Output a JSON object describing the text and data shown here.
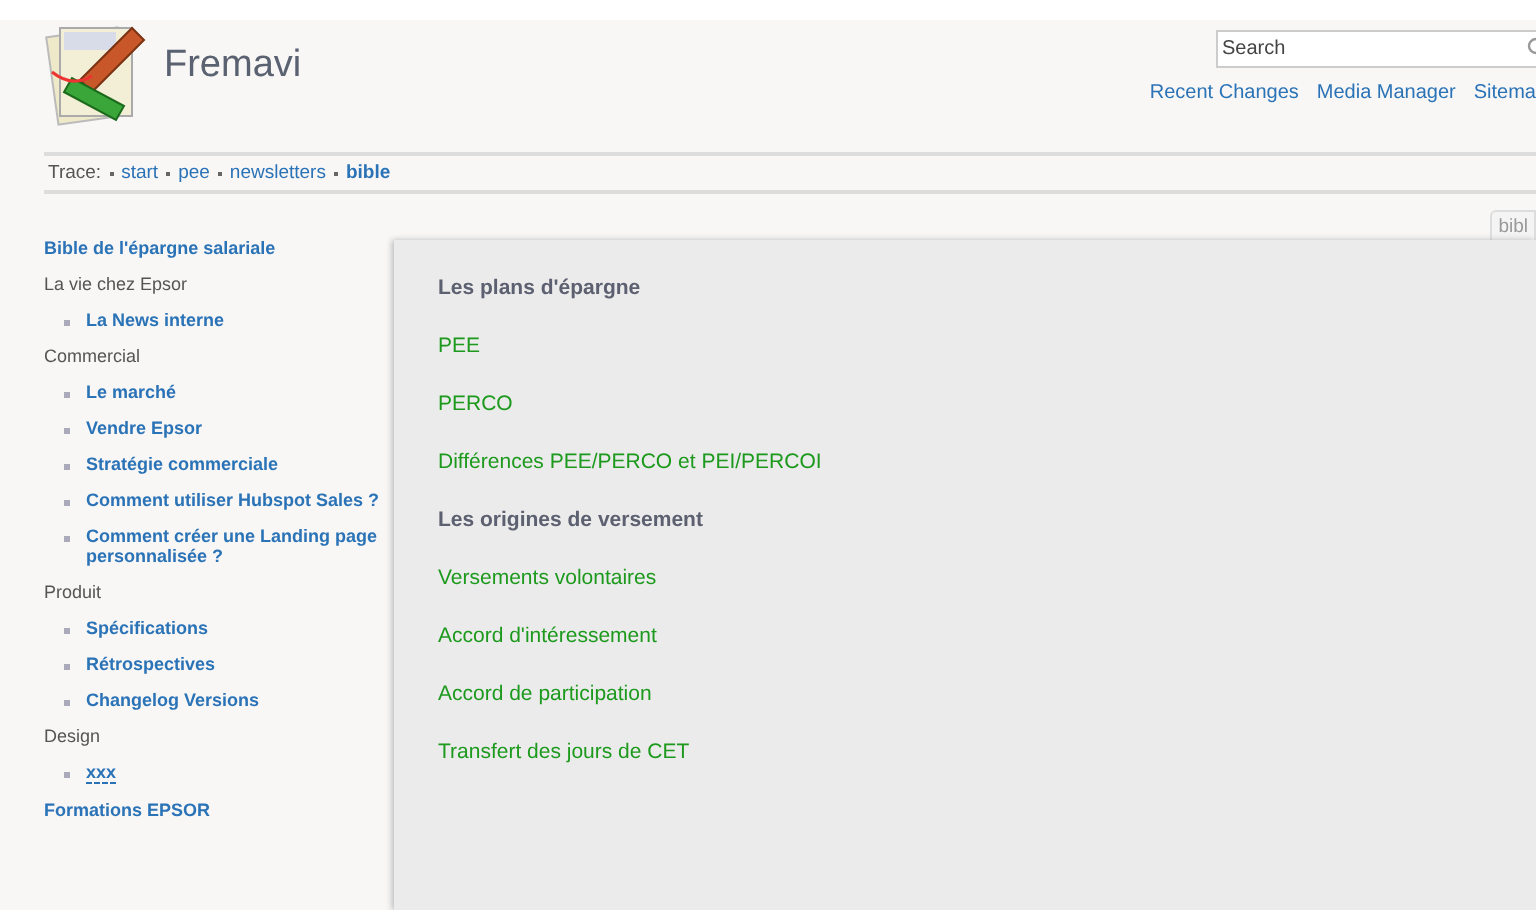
{
  "site": {
    "title": "Fremavi"
  },
  "search": {
    "placeholder": "Search"
  },
  "header_links": [
    "Recent Changes",
    "Media Manager",
    "Sitema"
  ],
  "trace": {
    "label": "Trace:",
    "crumbs": [
      {
        "text": "start",
        "current": false
      },
      {
        "text": "pee",
        "current": false
      },
      {
        "text": "newsletters",
        "current": false
      },
      {
        "text": "bible",
        "current": true
      }
    ]
  },
  "sidebar": {
    "items": [
      {
        "kind": "link",
        "text": "Bible de l'épargne salariale"
      },
      {
        "kind": "heading",
        "text": "La vie chez Epsor"
      },
      {
        "kind": "item",
        "text": "La News interne"
      },
      {
        "kind": "heading",
        "text": "Commercial"
      },
      {
        "kind": "item",
        "text": "Le marché"
      },
      {
        "kind": "item",
        "text": "Vendre Epsor"
      },
      {
        "kind": "item",
        "text": "Stratégie commerciale"
      },
      {
        "kind": "item",
        "text": "Comment utiliser Hubspot Sales ?"
      },
      {
        "kind": "item",
        "text": "Comment créer une Landing page personnalisée ?"
      },
      {
        "kind": "heading",
        "text": "Produit"
      },
      {
        "kind": "item",
        "text": "Spécifications"
      },
      {
        "kind": "item",
        "text": "Rétrospectives"
      },
      {
        "kind": "item",
        "text": "Changelog Versions"
      },
      {
        "kind": "heading",
        "text": "Design"
      },
      {
        "kind": "missing_item",
        "text": "xxx"
      },
      {
        "kind": "link",
        "text": "Formations EPSOR"
      }
    ]
  },
  "page_tab": "bibl",
  "content": [
    {
      "kind": "heading",
      "text": "Les plans d'épargne"
    },
    {
      "kind": "link",
      "text": "PEE"
    },
    {
      "kind": "link",
      "text": "PERCO"
    },
    {
      "kind": "link",
      "text": "Différences PEE/PERCO et PEI/PERCOI"
    },
    {
      "kind": "heading",
      "text": "Les origines de versement"
    },
    {
      "kind": "link",
      "text": "Versements volontaires"
    },
    {
      "kind": "link",
      "text": "Accord d'intéressement"
    },
    {
      "kind": "link",
      "text": "Accord de participation"
    },
    {
      "kind": "link",
      "text": "Transfert des jours de CET"
    }
  ]
}
